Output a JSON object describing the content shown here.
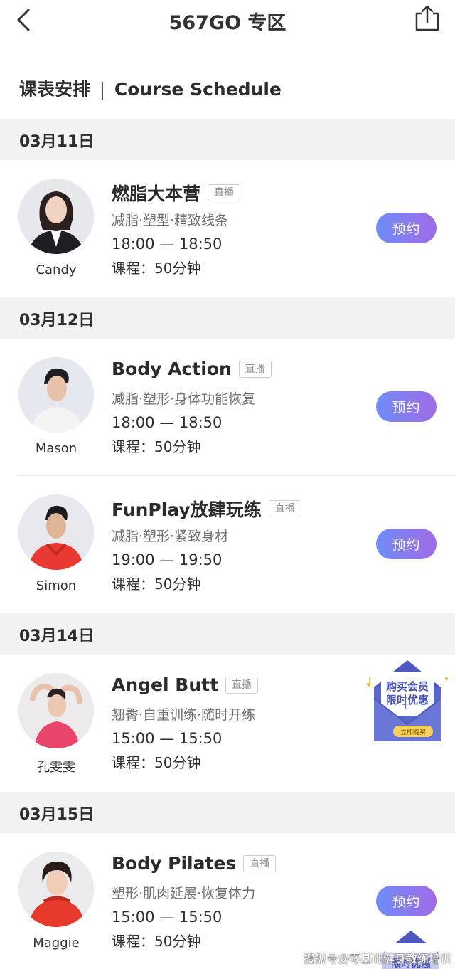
{
  "header": {
    "title": "567GO 专区"
  },
  "section": {
    "title_cn": "课表安排",
    "separator": "|",
    "title_en": "Course Schedule"
  },
  "live_tag": "直播",
  "book_label": "预约",
  "days": [
    {
      "date": "03月11日"
    },
    {
      "date": "03月12日"
    },
    {
      "date": "03月14日"
    },
    {
      "date": "03月15日"
    }
  ],
  "courses": [
    {
      "coach": "Candy",
      "title": "燃脂大本营",
      "desc": "减脂·塑型·精致线条",
      "time": "18:00 — 18:50",
      "duration": "课程：50分钟",
      "bookable": true
    },
    {
      "coach": "Mason",
      "title": "Body Action",
      "desc": "减脂·塑形·身体功能恢复",
      "time": "18:00 — 18:50",
      "duration": "课程：50分钟",
      "bookable": true
    },
    {
      "coach": "Simon",
      "title": "FunPlay放肆玩练",
      "desc": "减脂·塑形·紧致身材",
      "time": "19:00 — 19:50",
      "duration": "课程：50分钟",
      "bookable": true
    },
    {
      "coach": "孔雯雯",
      "title": "Angel Butt",
      "desc": "翘臀·自重训练·随时开练",
      "time": "15:00 — 15:50",
      "duration": "课程：50分钟",
      "bookable": false
    },
    {
      "coach": "Maggie",
      "title": "Body Pilates",
      "desc": "塑形·肌肉延展·恢复体力",
      "time": "15:00 — 15:50",
      "duration": "课程：50分钟",
      "bookable": true
    }
  ],
  "promo": {
    "line1": "购买会员",
    "line2": "限时优惠",
    "button": "立即购买",
    "peek_line": "限时优惠"
  },
  "watermark": "搜狐号@零基础健身教练培训",
  "colors": {
    "button_gradient_start": "#6f8cf7",
    "button_gradient_end": "#a06be6",
    "date_bar_bg": "#f2f2f2",
    "promo_envelope": "#5b66c9"
  }
}
